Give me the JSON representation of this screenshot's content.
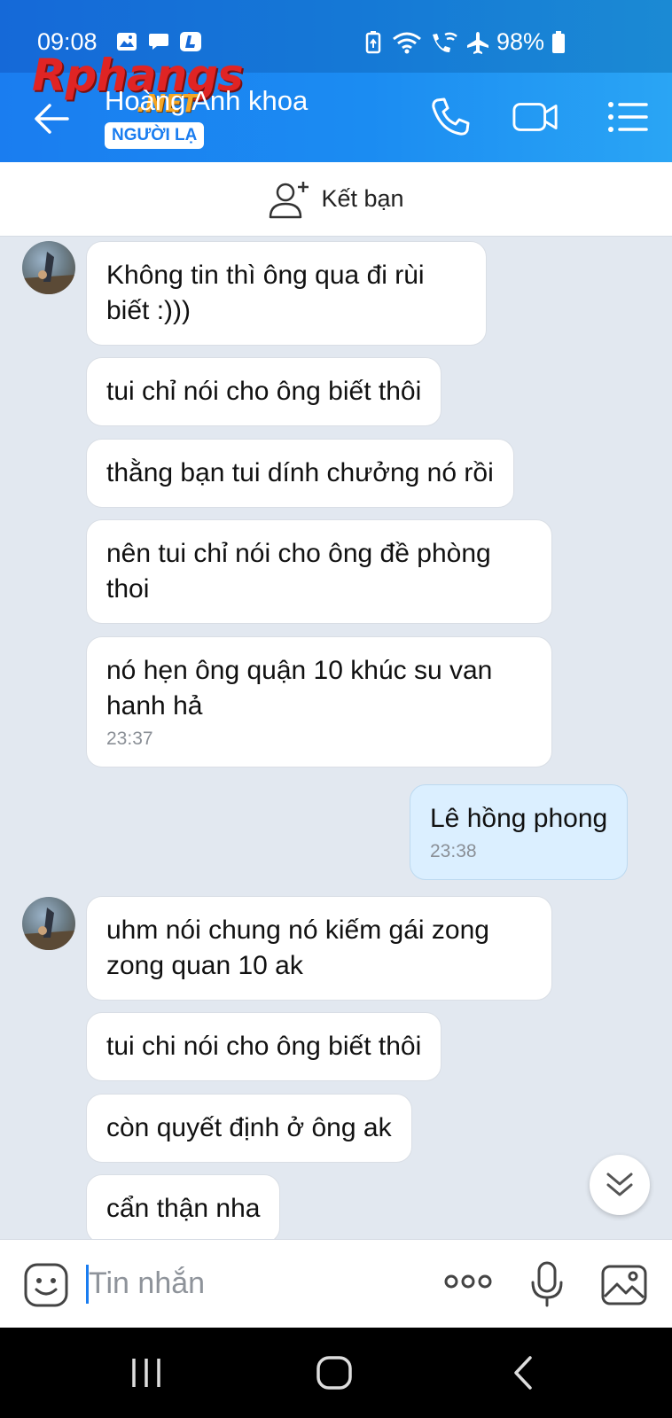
{
  "status_bar": {
    "time": "09:08",
    "battery": "98%",
    "left_icons": [
      "gallery-icon",
      "chat-bubble-icon",
      "l-app-icon"
    ],
    "right_icons": [
      "battery-saver-icon",
      "wifi-icon",
      "wifi-calling-icon",
      "airplane-icon",
      "battery-icon"
    ]
  },
  "watermark": {
    "main": "Rphangs",
    "suffix": ".NET"
  },
  "header": {
    "contact_name": "Hoàng Anh khoa",
    "badge": "NGƯỜI LẠ",
    "buttons": [
      "back-arrow-icon",
      "phone-icon",
      "video-call-icon",
      "menu-list-icon"
    ]
  },
  "friend_bar": {
    "label": "Kết bạn",
    "icon": "add-friend-icon"
  },
  "messages": [
    {
      "sender": "them",
      "text": "Không tin thì ông qua đi rùi biết :)))",
      "time": ""
    },
    {
      "sender": "them",
      "text": "tui chỉ nói cho ông biết thôi",
      "time": ""
    },
    {
      "sender": "them",
      "text": "thằng bạn tui dính chưởng nó rồi",
      "time": ""
    },
    {
      "sender": "them",
      "text": "nên tui chỉ nói cho ông đề phòng thoi",
      "time": ""
    },
    {
      "sender": "them",
      "text": "nó hẹn ông quận 10 khúc su van hanh hả",
      "time": "23:37"
    },
    {
      "sender": "me",
      "text": "Lê hồng phong",
      "time": "23:38"
    },
    {
      "sender": "them",
      "text": "uhm nói chung nó kiếm gái zong zong quan 10 ak",
      "time": ""
    },
    {
      "sender": "them",
      "text": "tui chi nói cho ông biết thôi",
      "time": ""
    },
    {
      "sender": "them",
      "text": "còn quyết định ở ông ak",
      "time": ""
    },
    {
      "sender": "them",
      "text": "cẩn thận nha",
      "time": ""
    }
  ],
  "input": {
    "placeholder": "Tin nhắn",
    "value": ""
  },
  "nav": {
    "buttons": [
      "recents-icon",
      "home-icon",
      "back-icon"
    ]
  },
  "colors": {
    "header": "#1a7df0",
    "chat_bg": "#e2e8f0",
    "my_bubble": "#dbefff",
    "their_bubble": "#ffffff"
  }
}
